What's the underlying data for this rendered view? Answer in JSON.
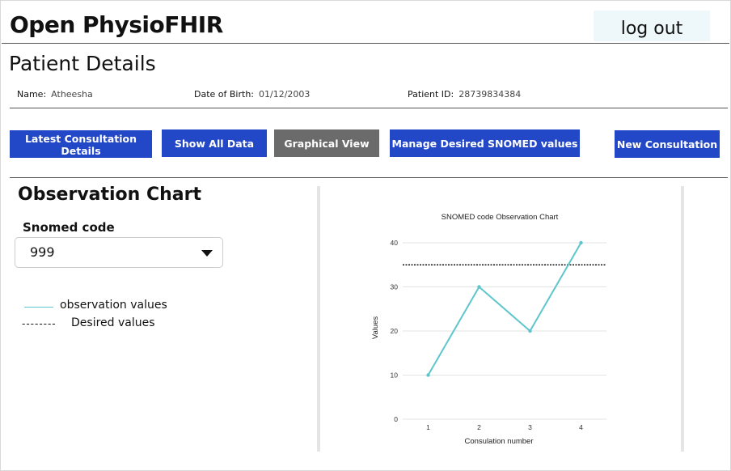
{
  "header": {
    "app_title": "Open PhysioFHIR",
    "logout_label": "log out"
  },
  "patient": {
    "section_title": "Patient Details",
    "name_label": "Name:",
    "name_value": "Atheesha",
    "dob_label": "Date of Birth:",
    "dob_value": "01/12/2003",
    "id_label": "Patient ID:",
    "id_value": "28739834384"
  },
  "actions": {
    "latest": "Latest Consultation Details",
    "show_all": "Show All Data",
    "graphical": "Graphical View",
    "manage": "Manage Desired SNOMED values",
    "new": "New Consultation"
  },
  "observation": {
    "title": "Observation Chart",
    "snomed_label": "Snomed code",
    "snomed_selected": "999",
    "legend_observed": "observation values",
    "legend_desired": "Desired values",
    "legend_observed_marker": "______",
    "legend_desired_marker": "--------"
  },
  "colors": {
    "primary_button": "#2348c7",
    "active_button": "#6b6b6b",
    "series": "#5cc6cc"
  },
  "chart_data": {
    "type": "line",
    "title": "SNOMED code Observation Chart",
    "xlabel": "Consulation number",
    "ylabel": "Values",
    "x": [
      1,
      2,
      3,
      4
    ],
    "series": [
      {
        "values": [
          10,
          30,
          20,
          40
        ]
      }
    ],
    "desired_value": 35,
    "xticks": [
      "1",
      "2",
      "3",
      "4"
    ],
    "yticks": [
      0,
      10,
      20,
      30,
      40
    ],
    "ylim": [
      0,
      40
    ],
    "xlim": [
      0.5,
      4.5
    ],
    "grid": true
  }
}
